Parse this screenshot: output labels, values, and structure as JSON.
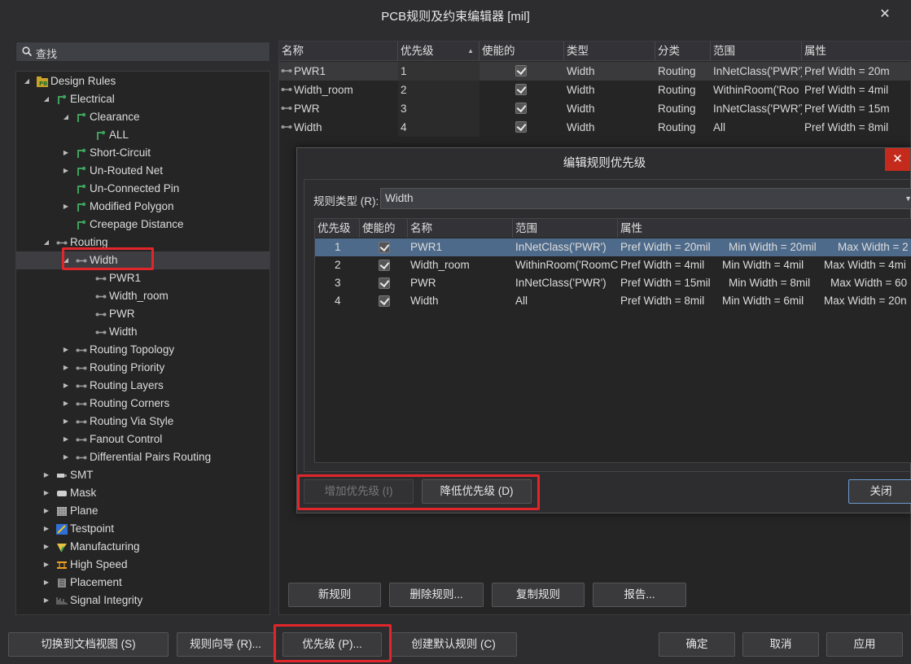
{
  "window": {
    "title": "PCB规则及约束编辑器 [mil]",
    "close_glyph": "✕"
  },
  "search": {
    "placeholder": "查找"
  },
  "tree": {
    "root": "Design Rules",
    "electrical": "Electrical",
    "clearance": "Clearance",
    "all": "ALL",
    "short_circuit": "Short-Circuit",
    "unrouted_net": "Un-Routed Net",
    "unconnected_pin": "Un-Connected Pin",
    "modified_polygon": "Modified Polygon",
    "creepage": "Creepage Distance",
    "routing": "Routing",
    "width": "Width",
    "width_children": [
      "PWR1",
      "Width_room",
      "PWR",
      "Width"
    ],
    "routing_topology": "Routing Topology",
    "routing_priority": "Routing Priority",
    "routing_layers": "Routing Layers",
    "routing_corners": "Routing Corners",
    "routing_via_style": "Routing Via Style",
    "fanout_control": "Fanout Control",
    "diff_pairs": "Differential Pairs Routing",
    "smt": "SMT",
    "mask": "Mask",
    "plane": "Plane",
    "testpoint": "Testpoint",
    "manufacturing": "Manufacturing",
    "high_speed": "High Speed",
    "placement": "Placement",
    "signal_integrity": "Signal Integrity"
  },
  "grid": {
    "headers": [
      "名称",
      "优先级",
      "使能的",
      "类型",
      "分类",
      "范围",
      "属性"
    ],
    "rows": [
      {
        "name": "PWR1",
        "priority": "1",
        "type": "Width",
        "category": "Routing",
        "scope": "InNetClass('PWR')",
        "attr": "Pref Width = 20m"
      },
      {
        "name": "Width_room",
        "priority": "2",
        "type": "Width",
        "category": "Routing",
        "scope": "WithinRoom('Roo",
        "attr": "Pref Width = 4mil"
      },
      {
        "name": "PWR",
        "priority": "3",
        "type": "Width",
        "category": "Routing",
        "scope": "InNetClass('PWR')",
        "attr": "Pref Width = 15m"
      },
      {
        "name": "Width",
        "priority": "4",
        "type": "Width",
        "category": "Routing",
        "scope": "All",
        "attr": "Pref Width = 8mil"
      }
    ]
  },
  "dialog": {
    "title": "编辑规则优先级",
    "close_glyph": "✕",
    "rule_type_label": "规则类型 (R):",
    "rule_type_value": "Width",
    "headers": [
      "优先级",
      "使能的",
      "名称",
      "范围",
      "属性"
    ],
    "rows": [
      {
        "priority": "1",
        "name": "PWR1",
        "scope": "InNetClass('PWR')",
        "pref": "Pref Width = 20mil",
        "min": "Min Width = 20mil",
        "max": "Max Width = 2"
      },
      {
        "priority": "2",
        "name": "Width_room",
        "scope": "WithinRoom('RoomC",
        "pref": "Pref Width = 4mil",
        "min": "Min Width = 4mil",
        "max": "Max Width = 4mi"
      },
      {
        "priority": "3",
        "name": "PWR",
        "scope": "InNetClass('PWR')",
        "pref": "Pref Width = 15mil",
        "min": "Min Width = 8mil",
        "max": "Max Width = 60"
      },
      {
        "priority": "4",
        "name": "Width",
        "scope": "All",
        "pref": "Pref Width = 8mil",
        "min": "Min Width = 6mil",
        "max": "Max Width = 20n"
      }
    ],
    "increase_btn": "增加优先级 (I)",
    "decrease_btn": "降低优先级 (D)",
    "close_btn": "关闭"
  },
  "grid_buttons": {
    "new_rule": "新规则",
    "delete_rule": "删除规则...",
    "copy_rule": "复制规则",
    "report": "报告..."
  },
  "footer": {
    "doc_view": "切换到文档视图 (S)",
    "wizard": "规则向导 (R)...",
    "priority": "优先级 (P)...",
    "create_default": "创建默认规则 (C)",
    "ok": "确定",
    "cancel": "取消",
    "apply": "应用"
  },
  "colors": {
    "highlight_box": "#e0262b",
    "selected_row": "#4e6a8a",
    "close_red": "#c42b1c"
  }
}
